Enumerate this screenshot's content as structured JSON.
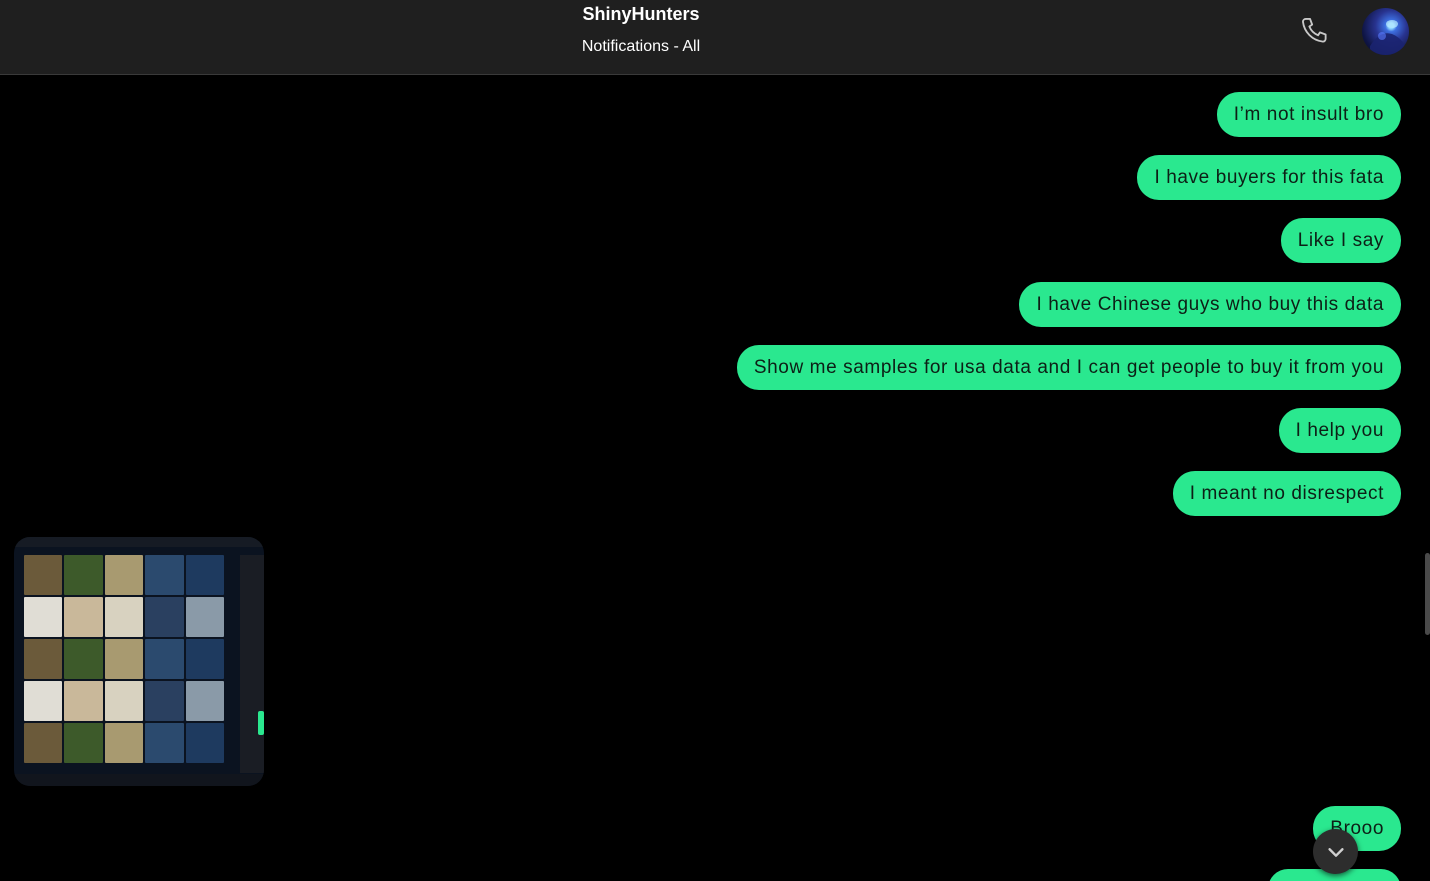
{
  "header": {
    "title": "ShinyHunters",
    "subtitle": "Notifications - All"
  },
  "icons": {
    "call": "phone-icon",
    "avatar": "avatar",
    "scroll": "chevron-down-icon"
  },
  "colors": {
    "bubble": "#2ae88f",
    "header_bg": "#1f1f1f",
    "background": "#000000"
  },
  "messages": [
    {
      "text": "I’m not insult bro"
    },
    {
      "text": "I have buyers for this fata"
    },
    {
      "text": "Like I say"
    },
    {
      "text": "I have Chinese guys who buy this data"
    },
    {
      "text": "Show me samples for usa data and I can get people to buy it from you"
    },
    {
      "text": "I help you"
    },
    {
      "text": "I meant no disrespect"
    },
    {
      "text": "Brooo"
    }
  ]
}
